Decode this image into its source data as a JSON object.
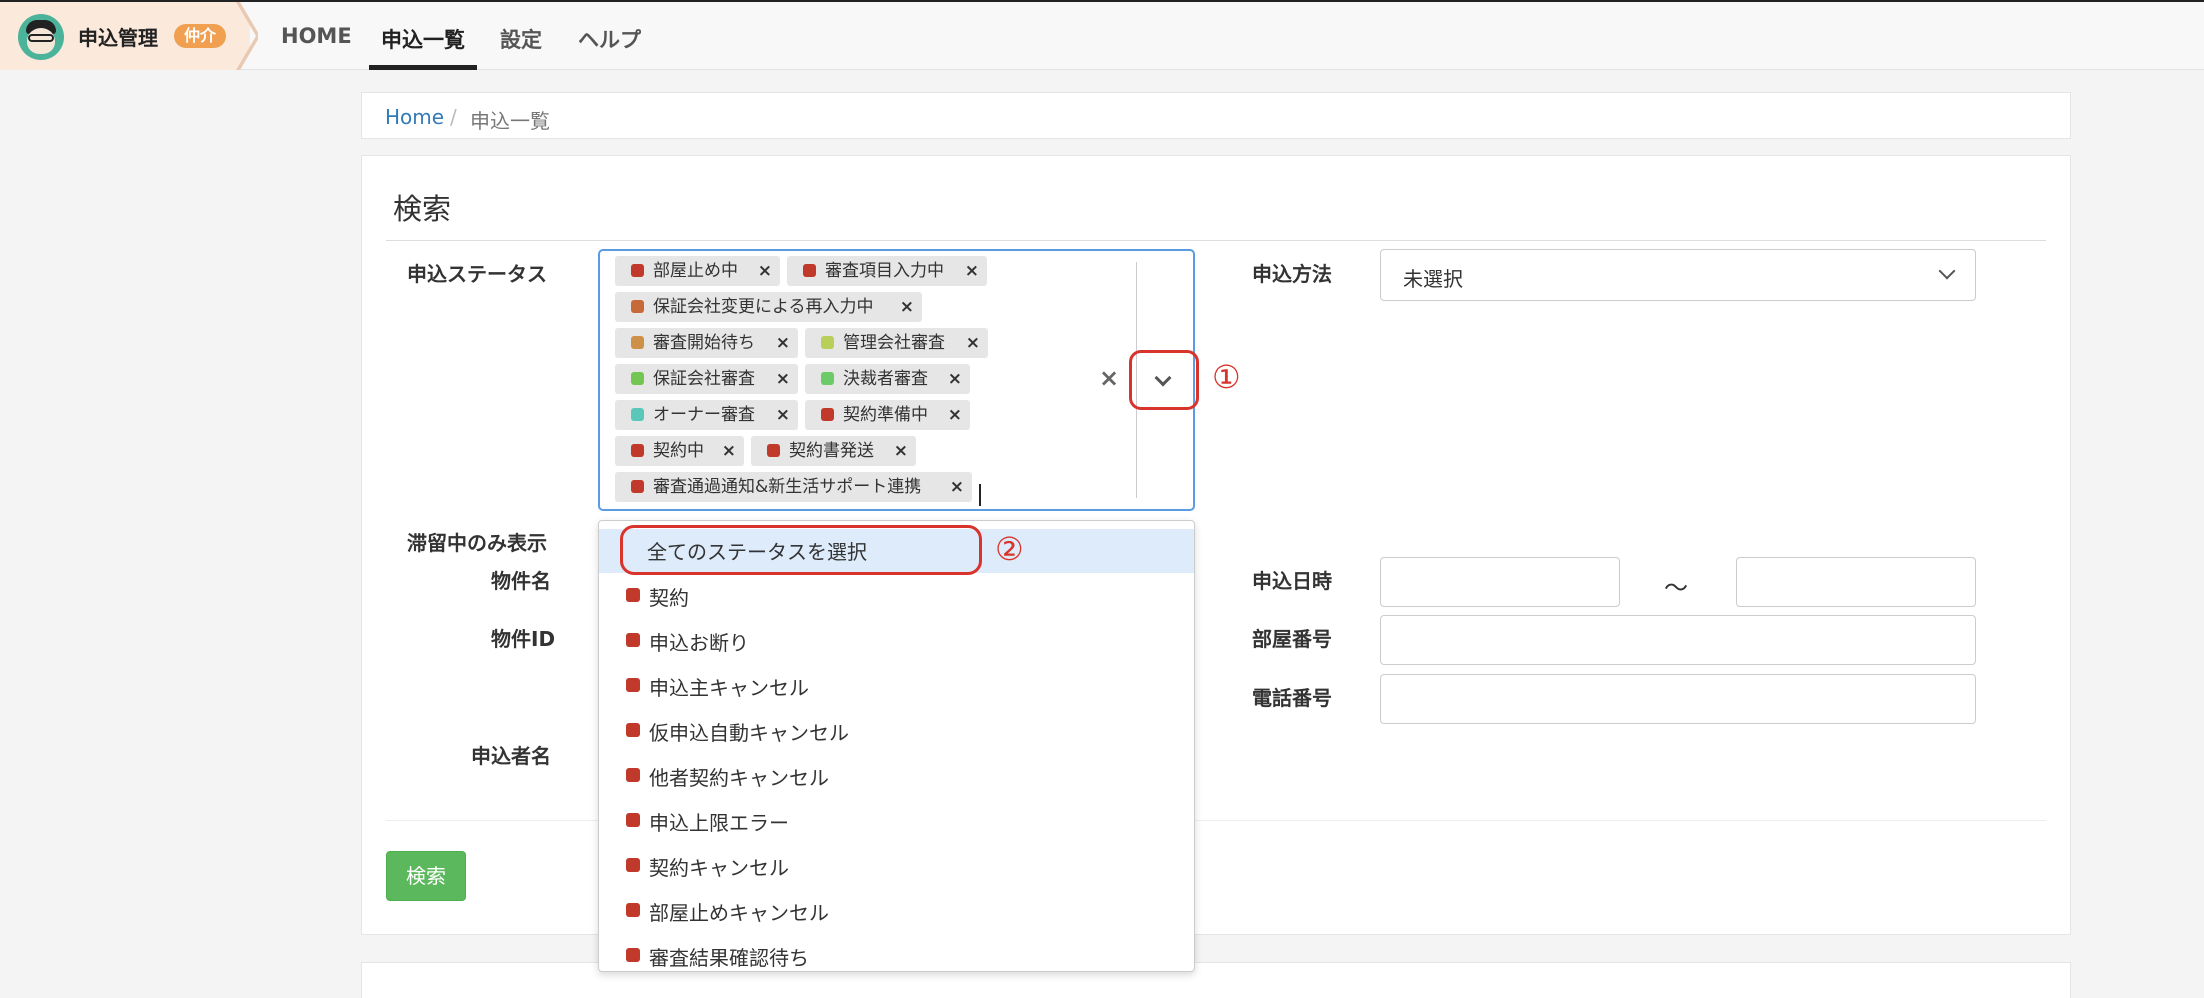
{
  "brand": {
    "title": "申込管理",
    "badge": "仲介"
  },
  "nav": [
    {
      "label": "HOME"
    },
    {
      "label": "申込一覧"
    },
    {
      "label": "設定"
    },
    {
      "label": "ヘルプ"
    }
  ],
  "breadcrumb": {
    "home": "Home",
    "separator": "/",
    "current": "申込一覧"
  },
  "search": {
    "title": "検索",
    "labels": {
      "status": "申込ステータス",
      "stagnant": "滞留中のみ表示",
      "property_name": "物件名",
      "property_id": "物件ID",
      "applicant_name": "申込者名",
      "method": "申込方法",
      "date": "申込日時",
      "room": "部屋番号",
      "phone": "電話番号"
    },
    "method_value": "未選択",
    "date_separator": "～",
    "clear_symbol": "×",
    "search_button": "検索",
    "selected_chips": [
      {
        "label": "部屋止め中",
        "color": "#c0392b"
      },
      {
        "label": "審査項目入力中",
        "color": "#c0392b"
      },
      {
        "label": "保証会社変更による再入力中",
        "color": "#c8693a"
      },
      {
        "label": "審査開始待ち",
        "color": "#cc9147"
      },
      {
        "label": "管理会社審査",
        "color": "#b8cf5a"
      },
      {
        "label": "保証会社審査",
        "color": "#74c653"
      },
      {
        "label": "決裁者審査",
        "color": "#6ccb66"
      },
      {
        "label": "オーナー審査",
        "color": "#5bc7b9"
      },
      {
        "label": "契約準備中",
        "color": "#c0392b"
      },
      {
        "label": "契約中",
        "color": "#c0392b"
      },
      {
        "label": "契約書発送",
        "color": "#c0392b"
      },
      {
        "label": "審査通過通知&新生活サポート連携",
        "color": "#c0392b"
      }
    ],
    "chip_remove": "×",
    "dropdown": {
      "select_all": "全てのステータスを選択",
      "options": [
        {
          "label": "契約",
          "color": "#c0392b"
        },
        {
          "label": "申込お断り",
          "color": "#c0392b"
        },
        {
          "label": "申込主キャンセル",
          "color": "#c0392b"
        },
        {
          "label": "仮申込自動キャンセル",
          "color": "#c0392b"
        },
        {
          "label": "他者契約キャンセル",
          "color": "#c0392b"
        },
        {
          "label": "申込上限エラー",
          "color": "#c0392b"
        },
        {
          "label": "契約キャンセル",
          "color": "#c0392b"
        },
        {
          "label": "部屋止めキャンセル",
          "color": "#c0392b"
        },
        {
          "label": "審査結果確認待ち",
          "color": "#c0392b"
        }
      ]
    }
  },
  "annotations": {
    "one": "①",
    "two": "②"
  },
  "colors": {
    "accent": "#5b9be5",
    "annotation": "#d9342b",
    "primary_button": "#5cb85c",
    "link": "#337ab7"
  }
}
